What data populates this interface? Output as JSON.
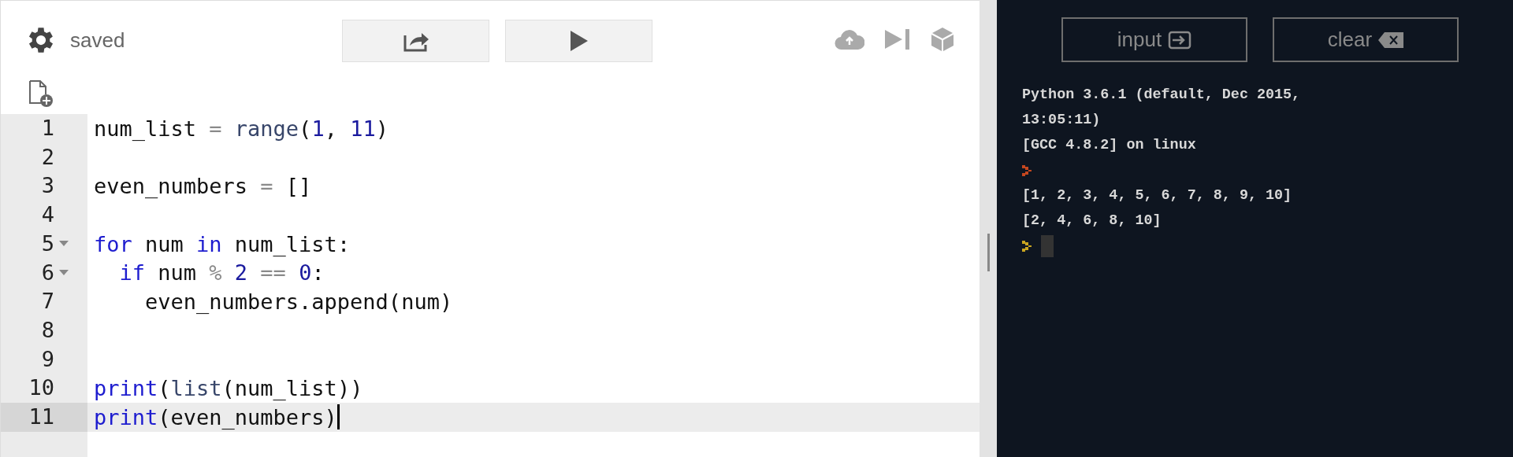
{
  "toolbar": {
    "status": "saved"
  },
  "editor": {
    "lines": [
      {
        "number": "1",
        "foldable": false,
        "selected": false,
        "tokens": [
          {
            "kind": "text",
            "text": "num_list "
          },
          {
            "kind": "operator",
            "text": "= "
          },
          {
            "kind": "builtin",
            "text": "range"
          },
          {
            "kind": "text",
            "text": "("
          },
          {
            "kind": "number",
            "text": "1"
          },
          {
            "kind": "text",
            "text": ", "
          },
          {
            "kind": "number",
            "text": "11"
          },
          {
            "kind": "text",
            "text": ")"
          }
        ]
      },
      {
        "number": "2",
        "foldable": false,
        "selected": false
      },
      {
        "number": "3",
        "foldable": false,
        "selected": false,
        "tokens": [
          {
            "kind": "text",
            "text": "even_numbers "
          },
          {
            "kind": "operator",
            "text": "="
          },
          {
            "kind": "text",
            "text": " []"
          }
        ]
      },
      {
        "number": "4",
        "foldable": false,
        "selected": false
      },
      {
        "number": "5",
        "foldable": true,
        "selected": false,
        "tokens": [
          {
            "kind": "keyword",
            "text": "for"
          },
          {
            "kind": "text",
            "text": " num "
          },
          {
            "kind": "keyword",
            "text": "in"
          },
          {
            "kind": "text",
            "text": " num_list:"
          }
        ]
      },
      {
        "number": "6",
        "foldable": true,
        "selected": false,
        "tokens": [
          {
            "kind": "keyword",
            "text": "  if"
          },
          {
            "kind": "text",
            "text": " num "
          },
          {
            "kind": "operator",
            "text": "% "
          },
          {
            "kind": "number",
            "text": "2 "
          },
          {
            "kind": "operator",
            "text": "== "
          },
          {
            "kind": "number",
            "text": "0"
          },
          {
            "kind": "text",
            "text": ":"
          }
        ]
      },
      {
        "number": "7",
        "foldable": false,
        "selected": false,
        "tokens": [
          {
            "kind": "text",
            "text": "    even_numbers.append(num)"
          }
        ]
      },
      {
        "number": "8",
        "foldable": false,
        "selected": false
      },
      {
        "number": "9",
        "foldable": false,
        "selected": false
      },
      {
        "number": "10",
        "foldable": false,
        "selected": false,
        "tokens": [
          {
            "kind": "keyword",
            "text": "print"
          },
          {
            "kind": "text",
            "text": "("
          },
          {
            "kind": "builtin",
            "text": "list"
          },
          {
            "kind": "text",
            "text": "(num_list))"
          }
        ]
      },
      {
        "number": "11",
        "foldable": false,
        "selected": true,
        "tokens": [
          {
            "kind": "keyword",
            "text": "print"
          },
          {
            "kind": "text",
            "text": "(even_numbers)"
          }
        ]
      }
    ]
  },
  "console": {
    "buttons": [
      {
        "label": "input",
        "kind": "input"
      },
      {
        "label": "clear",
        "kind": "clear"
      }
    ],
    "lines": [
      {
        "kind": "text",
        "text": "Python 3.6.1 (default, Dec 2015,"
      },
      {
        "kind": "text",
        "text": "13:05:11)"
      },
      {
        "kind": "text",
        "text": "[GCC 4.8.2] on linux"
      },
      {
        "kind": "prompt",
        "color": "#c4471f",
        "active": false
      },
      {
        "kind": "text",
        "text": "[1, 2, 3, 4, 5, 6, 7, 8, 9, 10]"
      },
      {
        "kind": "text",
        "text": "[2, 4, 6, 8, 10]"
      },
      {
        "kind": "prompt",
        "color": "#c9a520",
        "active": true
      }
    ]
  }
}
